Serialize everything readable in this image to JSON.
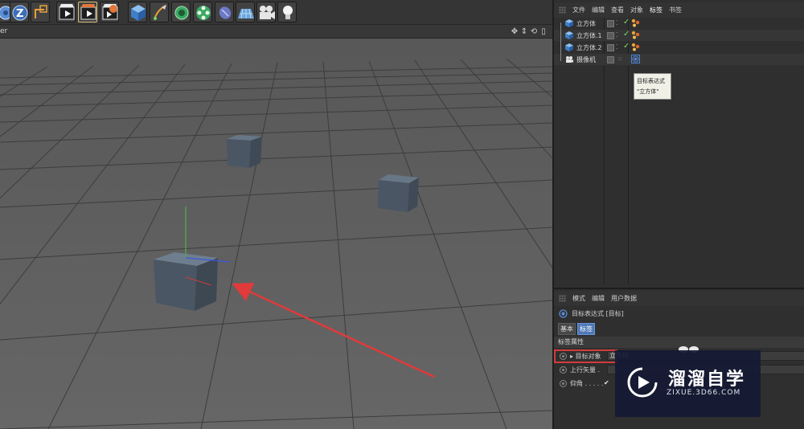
{
  "toolbar": {
    "icons": [
      "render-region-icon",
      "z-axis-icon",
      "world-coordinate-icon",
      "render-view-icon",
      "render-picture-viewer-icon",
      "render-settings-icon",
      "cube-icon",
      "pen-icon",
      "subdivision-icon",
      "array-icon",
      "deformer-icon",
      "floor-icon",
      "camera-icon",
      "light-icon"
    ]
  },
  "viewport": {
    "menu_stub": "er"
  },
  "object_manager": {
    "menu": [
      "文件",
      "编辑",
      "查看",
      "对象",
      "标签",
      "书签"
    ],
    "active_menu": "标签",
    "objects": [
      {
        "name": "立方体",
        "icon": "cube-icon",
        "tag": "texture-tag-icon"
      },
      {
        "name": "立方体.1",
        "icon": "cube-icon",
        "tag": "texture-tag-icon"
      },
      {
        "name": "立方体.2",
        "icon": "cube-icon",
        "tag": "texture-tag-icon"
      },
      {
        "name": "摄像机",
        "icon": "camera-icon",
        "tag": "target-tag-icon"
      }
    ],
    "tooltip": {
      "line1": "目标表达式",
      "line2": "\"立方体\""
    }
  },
  "attributes": {
    "menu": [
      "模式",
      "编辑",
      "用户数据"
    ],
    "title": "目标表达式 [目标]",
    "tabs": [
      "基本",
      "标签"
    ],
    "active_tab": "标签",
    "section": "标签属性",
    "properties": [
      {
        "label": "▸ 目标对象",
        "value": "立方体"
      },
      {
        "label": "上行矢量 .",
        "value": ""
      },
      {
        "label": "仰角 . . . . . ",
        "value": "✔"
      }
    ]
  },
  "watermark": {
    "title": "溜溜自学",
    "subtitle": "ZIXUE.3D66.COM"
  },
  "colors": {
    "accent_red": "#d33b3b",
    "selection_blue": "#4e78b8",
    "check_green": "#7bd36a"
  }
}
